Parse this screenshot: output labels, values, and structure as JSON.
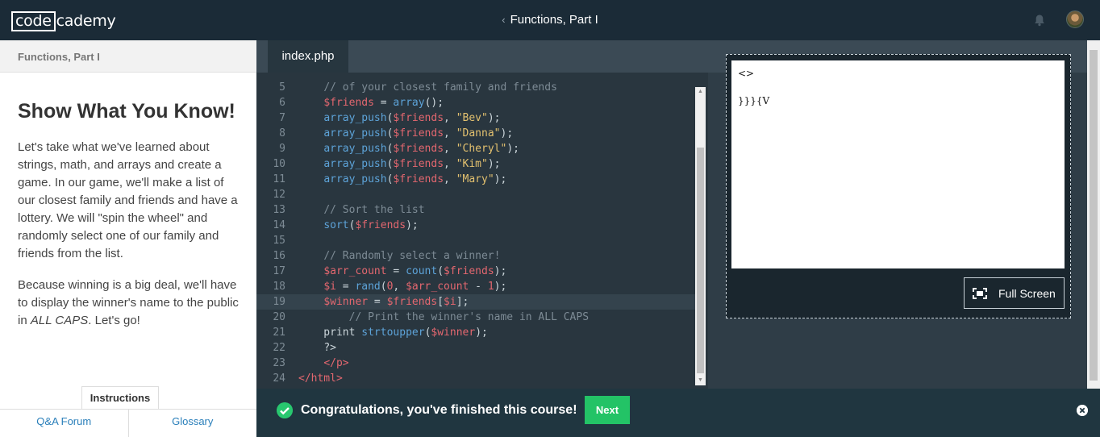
{
  "topbar": {
    "logo_box": "code",
    "logo_rest": "cademy",
    "back_chevron": "‹",
    "course_title": "Functions, Part I"
  },
  "sidebar": {
    "header": "Functions, Part I",
    "title": "Show What You Know!",
    "para1": "Let's take what we've learned about strings, math, and arrays and create a game. In our game, we'll make a list of our closest family and friends and have a lottery. We will \"spin the wheel\" and randomly select one of our family and friends from the list.",
    "para2_pre": "Because winning is a big deal, we'll have to display the winner's name to the public in ",
    "para2_em": "ALL CAPS",
    "para2_post": ". Let's go!",
    "tabs": {
      "instructions": "Instructions",
      "qa": "Q&A Forum",
      "glossary": "Glossary"
    }
  },
  "editor": {
    "file_tab": "index.php",
    "lines": [
      {
        "n": "5",
        "code": "    // of your closest family and friends"
      },
      {
        "n": "6",
        "code": "    $friends = array();"
      },
      {
        "n": "7",
        "code": "    array_push($friends, \"Bev\");"
      },
      {
        "n": "8",
        "code": "    array_push($friends, \"Danna\");"
      },
      {
        "n": "9",
        "code": "    array_push($friends, \"Cheryl\");"
      },
      {
        "n": "10",
        "code": "    array_push($friends, \"Kim\");"
      },
      {
        "n": "11",
        "code": "    array_push($friends, \"Mary\");"
      },
      {
        "n": "12",
        "code": ""
      },
      {
        "n": "13",
        "code": "    // Sort the list"
      },
      {
        "n": "14",
        "code": "    sort($friends);"
      },
      {
        "n": "15",
        "code": ""
      },
      {
        "n": "16",
        "code": "    // Randomly select a winner!"
      },
      {
        "n": "17",
        "code": "    $arr_count = count($friends);"
      },
      {
        "n": "18",
        "code": "    $i = rand(0, $arr_count - 1);"
      },
      {
        "n": "19",
        "code": "    $winner = $friends[$i];"
      },
      {
        "n": "20",
        "code": "        // Print the winner's name in ALL CAPS"
      },
      {
        "n": "21",
        "code": "    print strtoupper($winner);"
      },
      {
        "n": "22",
        "code": "    ?>"
      },
      {
        "n": "23",
        "code": "    </p>"
      },
      {
        "n": "24",
        "code": "</html>"
      }
    ]
  },
  "preview": {
    "output_line1": "<>",
    "output_line2": "}}}{V",
    "fullscreen_label": "Full Screen"
  },
  "banner": {
    "message": "Congratulations, you've finished this course!",
    "next_label": "Next"
  }
}
